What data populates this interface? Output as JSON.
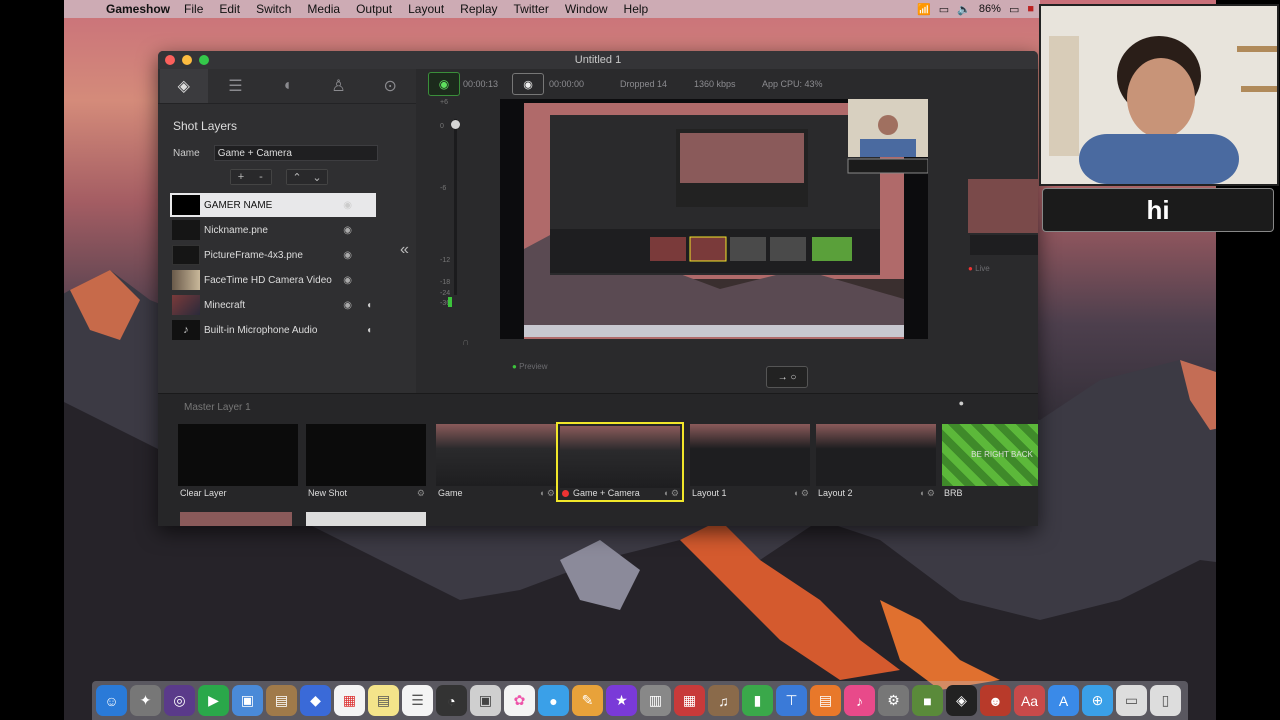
{
  "menubar": {
    "app_name": "Gameshow",
    "items": [
      "File",
      "Edit",
      "Switch",
      "Media",
      "Output",
      "Layout",
      "Replay",
      "Twitter",
      "Window",
      "Help"
    ],
    "battery": "86%"
  },
  "window": {
    "title": "Untitled 1"
  },
  "left_panel": {
    "section_title": "Shot Layers",
    "name_label": "Name",
    "name_value": "Game + Camera",
    "buttons": {
      "add": "+",
      "remove": "-",
      "up": "⌃",
      "down": "⌄"
    },
    "layers": [
      {
        "label": "GAMER NAME",
        "selected": true
      },
      {
        "label": "Nickname.pne",
        "selected": false
      },
      {
        "label": "PictureFrame-4x3.pne",
        "selected": false
      },
      {
        "label": "FaceTime HD Camera Video",
        "selected": false
      },
      {
        "label": "Minecraft",
        "selected": false
      },
      {
        "label": "Built-in Microphone Audio",
        "selected": false
      }
    ]
  },
  "status": {
    "stream_time": "00:00:13",
    "record_time": "00:00:00",
    "dropped": "Dropped 14",
    "bitrate": "1360 kbps",
    "cpu": "App CPU: 43%"
  },
  "meters": {
    "marks": [
      "+6",
      "0",
      "-6",
      "-12",
      "-18",
      "-24",
      "-36"
    ]
  },
  "preview": {
    "label": "Preview"
  },
  "live": {
    "label": "Live"
  },
  "transition": {
    "label": "→ ○"
  },
  "master": {
    "title": "Master Layer 1",
    "shots": [
      {
        "label": "Clear Layer",
        "selected": false
      },
      {
        "label": "New Shot",
        "selected": false
      },
      {
        "label": "Game",
        "selected": false
      },
      {
        "label": "Game + Camera",
        "selected": true
      },
      {
        "label": "Layout 1",
        "selected": false
      },
      {
        "label": "Layout 2",
        "selected": false
      },
      {
        "label": "BRB",
        "selected": false
      }
    ],
    "brb_text": "BE RIGHT BACK"
  },
  "overlay": {
    "caption": "hi"
  },
  "colors": {
    "accent_green": "#5ee05e",
    "selection_yellow": "#f1e72a",
    "record_red": "#e33333"
  }
}
